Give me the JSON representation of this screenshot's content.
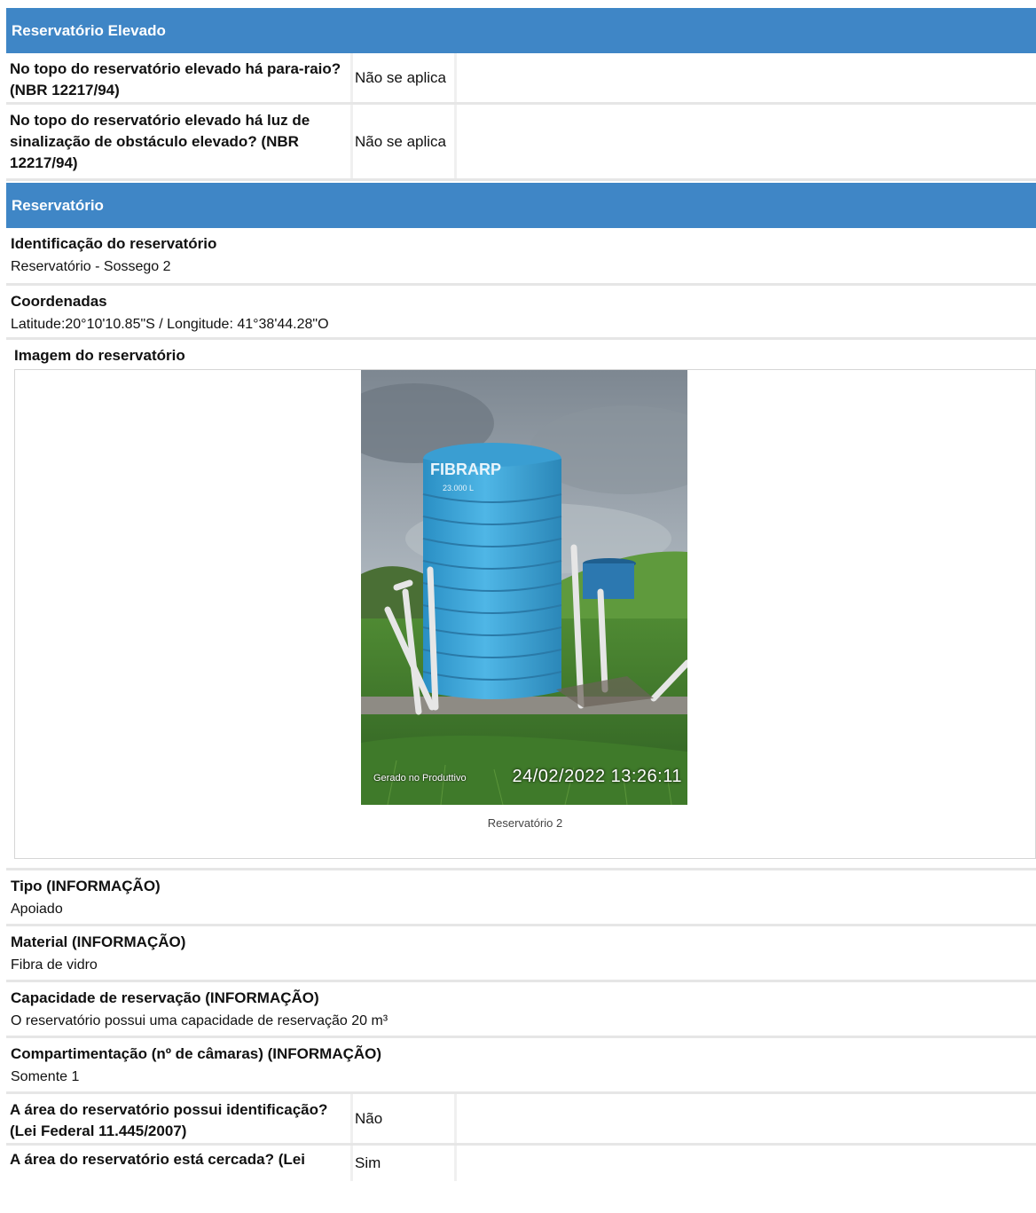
{
  "section_elevado": {
    "title": "Reservatório Elevado",
    "rows": [
      {
        "question": "No topo do reservatório elevado há para-raio? (NBR 12217/94)",
        "answer": "Não se aplica"
      },
      {
        "question": "No topo do reservatório elevado há luz de sinalização de obstáculo elevado? (NBR 12217/94)",
        "answer": "Não se aplica"
      }
    ]
  },
  "section_reservatorio": {
    "title": "Reservatório",
    "identificacao": {
      "label": "Identificação do reservatório",
      "value": "Reservatório - Sossego 2"
    },
    "coordenadas": {
      "label": "Coordenadas",
      "value": "Latitude:20°10'10.85\"S / Longitude: 41°38'44.28\"O"
    },
    "imagem": {
      "label": "Imagem do reservatório",
      "caption": "Reservatório 2",
      "photo_tank_text": "FIBRARP",
      "photo_tank_capacity": "23.000 L",
      "photo_watermark": "Gerado no Produttivo",
      "photo_timestamp": "24/02/2022 13:26:11"
    },
    "tipo": {
      "label": "Tipo (INFORMAÇÃO)",
      "value": "Apoiado"
    },
    "material": {
      "label": "Material (INFORMAÇÃO)",
      "value": "Fibra de vidro"
    },
    "capacidade": {
      "label": "Capacidade de reservação (INFORMAÇÃO)",
      "value": "O reservatório possui uma capacidade de reservação 20 m³"
    },
    "compartimentacao": {
      "label": "Compartimentação (nº de câmaras) (INFORMAÇÃO)",
      "value": "Somente 1"
    },
    "rows": [
      {
        "question": "A área do reservatório possui identificação? (Lei Federal 11.445/2007)",
        "answer": "Não"
      },
      {
        "question": "A área do reservatório está cercada? (Lei",
        "answer": "Sim"
      }
    ]
  }
}
